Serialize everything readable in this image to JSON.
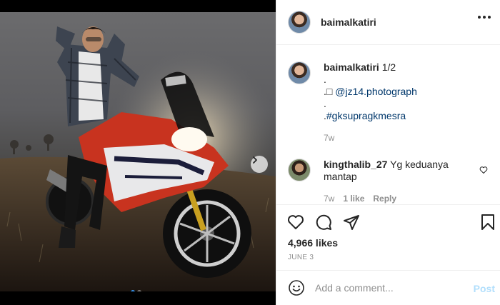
{
  "post": {
    "username": "baimalkatiri",
    "more_icon": "more-horizontal-icon"
  },
  "caption": {
    "username": "baimalkatiri",
    "text": "1/2",
    "line2": ".",
    "line3_prefix": ".",
    "line3_symbol": "□",
    "line3_link": "@jz14.photograph",
    "line4": ".",
    "line5_prefix": ".",
    "line5_link": "#gksupragkmesra",
    "time": "7w"
  },
  "comment": {
    "username": "kingthalib_27",
    "text": "Yg keduanya mantap",
    "time": "7w",
    "likes": "1 like",
    "reply": "Reply"
  },
  "actions": {
    "icons": [
      "heart-icon",
      "comment-icon",
      "share-icon",
      "bookmark-icon"
    ],
    "likes": "4,966 likes",
    "date": "JUNE 3"
  },
  "add_comment": {
    "placeholder": "Add a comment...",
    "post_label": "Post"
  },
  "carousel": {
    "slide_count": 2,
    "current": 1
  },
  "colors": {
    "link": "#00376b",
    "muted": "#8e8e8e",
    "post_disabled": "#b2dffc",
    "active_dot": "#3897f0"
  }
}
